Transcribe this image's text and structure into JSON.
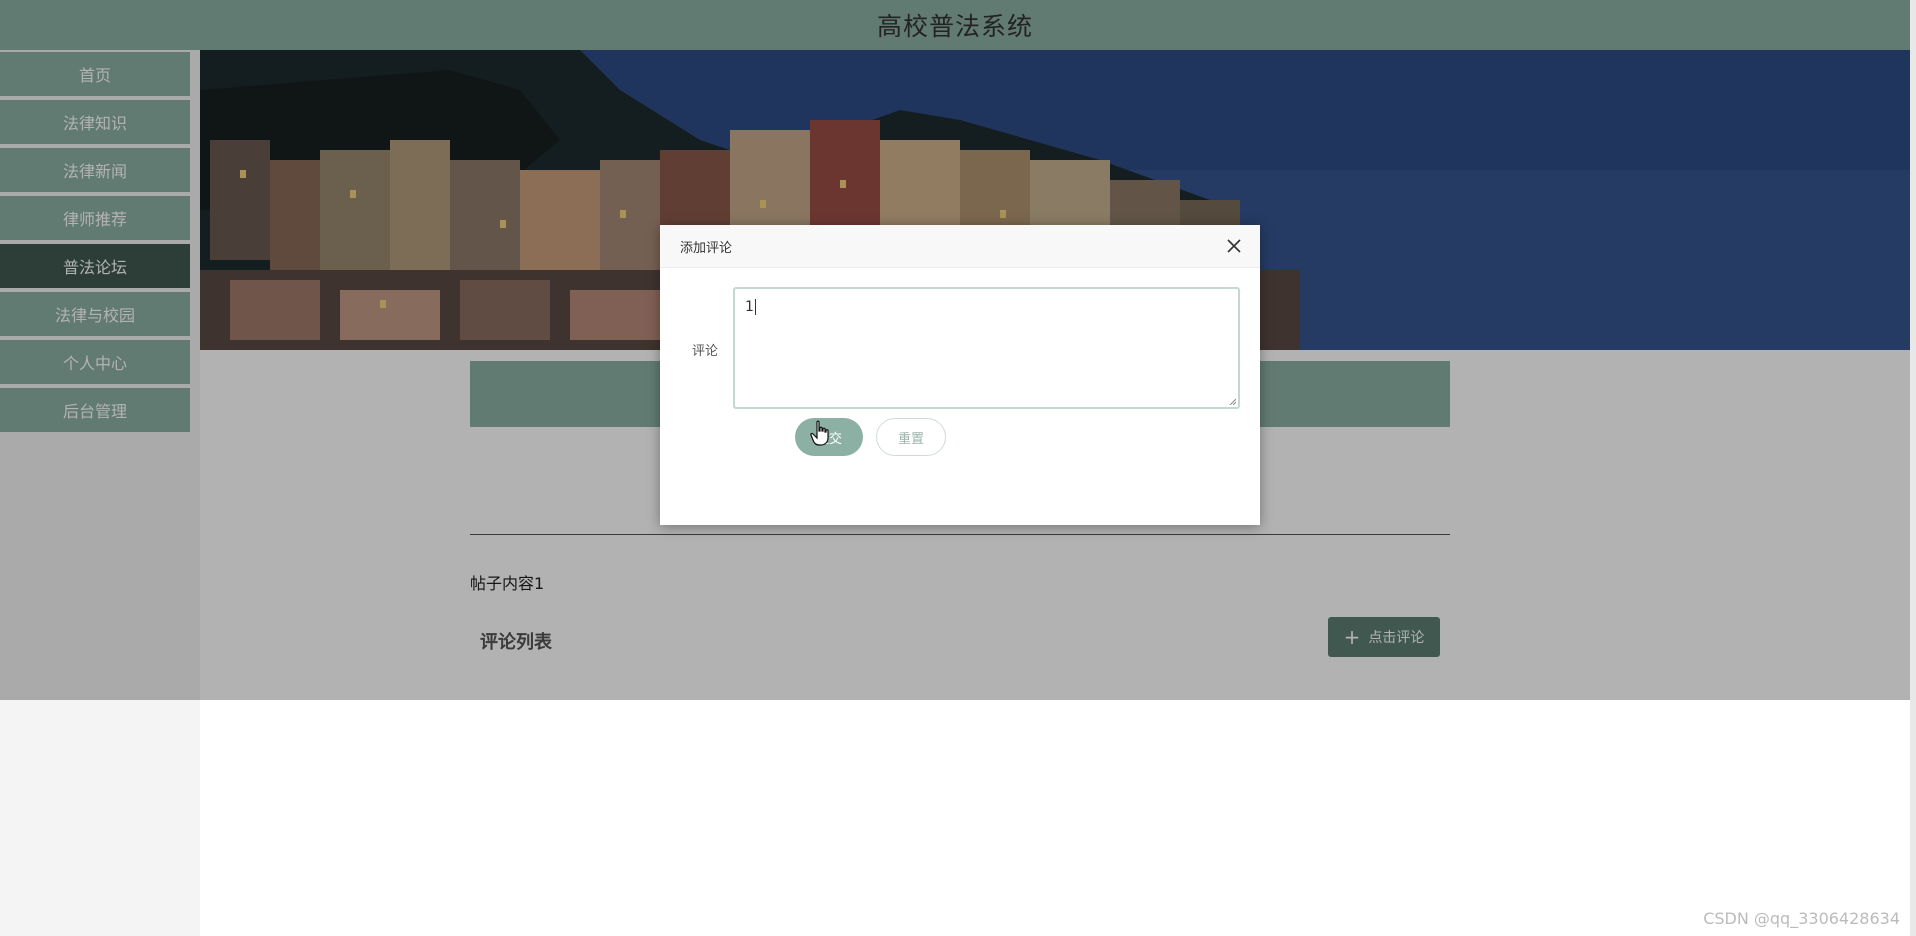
{
  "header": {
    "title": "高校普法系统"
  },
  "sidebar": {
    "items": [
      {
        "label": "首页",
        "active": false
      },
      {
        "label": "法律知识",
        "active": false
      },
      {
        "label": "法律新闻",
        "active": false
      },
      {
        "label": "律师推荐",
        "active": false
      },
      {
        "label": "普法论坛",
        "active": true
      },
      {
        "label": "法律与校园",
        "active": false
      },
      {
        "label": "个人中心",
        "active": false
      },
      {
        "label": "后台管理",
        "active": false
      }
    ]
  },
  "post": {
    "content": "帖子内容1",
    "comment_list_title": "评论列表",
    "add_comment_label": "点击评论"
  },
  "dialog": {
    "title": "添加评论",
    "field_label": "评论",
    "textarea_value": "1",
    "submit_label": "提交",
    "reset_label": "重置"
  },
  "watermark": "CSDN @qq_3306428634",
  "colors": {
    "primary": "#8cb0a4",
    "active_nav": "#3f5a50",
    "dark_button": "#5d7f73"
  },
  "icons": {
    "close": "close-icon",
    "plus": "plus-icon",
    "cursor": "hand-pointer-icon"
  }
}
